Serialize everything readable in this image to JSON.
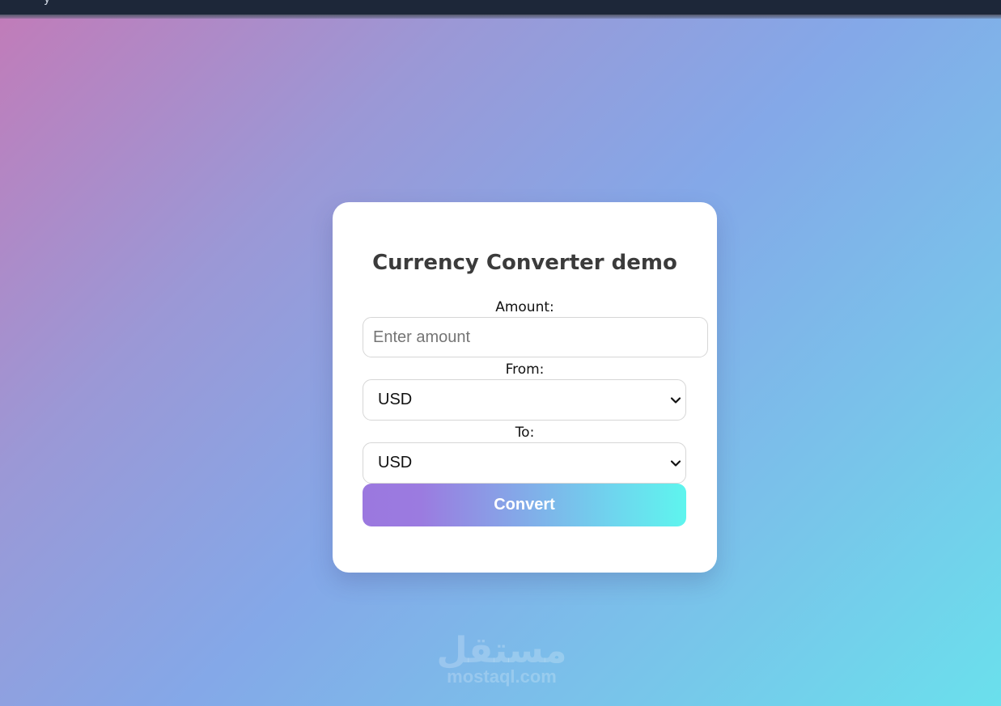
{
  "app": {
    "title": "Currency Converter demo"
  },
  "form": {
    "amount_label": "Amount:",
    "amount_value": "",
    "amount_placeholder": "Enter amount",
    "from_label": "From:",
    "from_selected": "USD",
    "to_label": "To:",
    "to_selected": "USD",
    "convert_label": "Convert"
  },
  "watermark": {
    "arabic": "مستقل",
    "latin": "mostaql.com"
  },
  "icons": {
    "select_chevron": "chevron-down-icon"
  },
  "colors": {
    "card_background": "#ffffff",
    "title_text": "#3b3b3b",
    "button_gradient_start": "#9b78df",
    "button_gradient_end": "#5ef5ee",
    "page_gradient_start": "#c27bb8",
    "page_gradient_end": "#6ae0ec",
    "topbar": "#1d2739"
  }
}
